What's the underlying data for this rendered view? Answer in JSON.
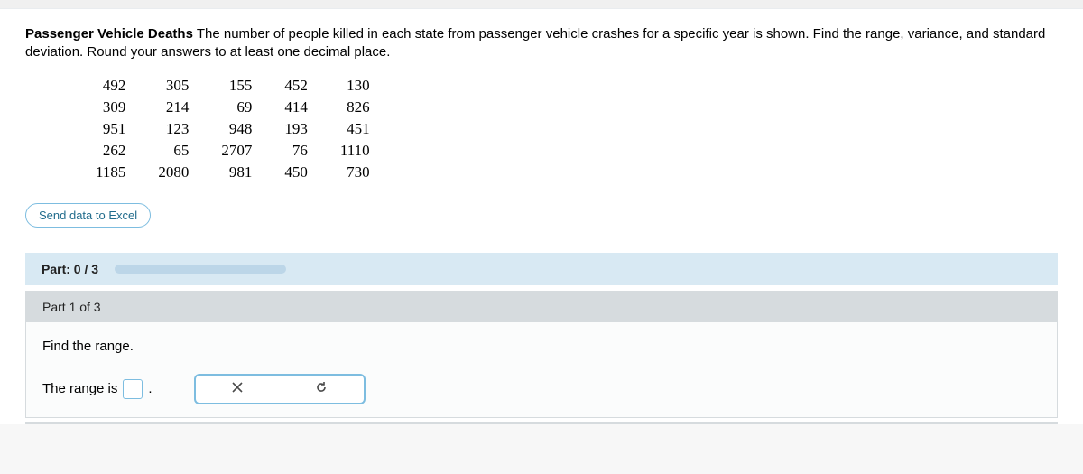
{
  "prompt": {
    "title": "Passenger Vehicle Deaths",
    "body": " The number of people killed in each state from passenger vehicle crashes for a specific year is shown. Find the range, variance, and standard deviation. Round your answers to at least one decimal place."
  },
  "data_grid": [
    [
      "492",
      "305",
      "155",
      "452",
      "130"
    ],
    [
      "309",
      "214",
      "69",
      "414",
      "826"
    ],
    [
      "951",
      "123",
      "948",
      "193",
      "451"
    ],
    [
      "262",
      "65",
      "2707",
      "76",
      "1110"
    ],
    [
      "1185",
      "2080",
      "981",
      "450",
      "730"
    ]
  ],
  "send_button": "Send data to Excel",
  "progress": {
    "label": "Part: 0 / 3"
  },
  "part": {
    "header": "Part 1 of 3",
    "question": "Find the range.",
    "answer_prefix": "The range is",
    "answer_value": "",
    "answer_suffix": "."
  },
  "icons": {
    "close": "close-icon",
    "reset": "reset-icon"
  }
}
